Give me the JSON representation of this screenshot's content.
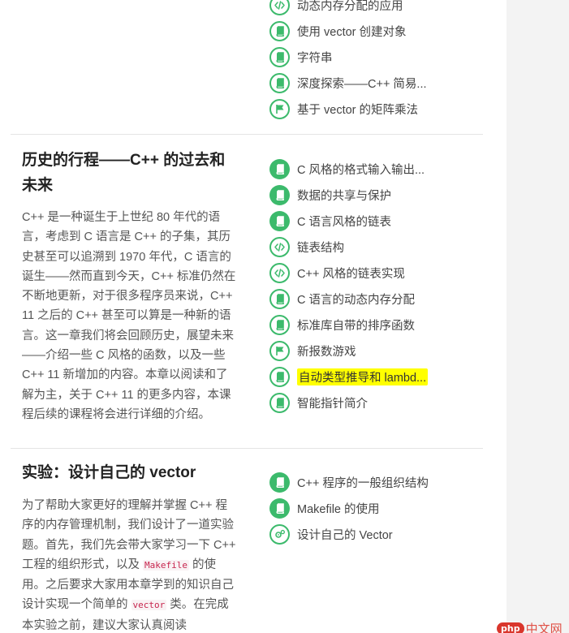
{
  "chapters": [
    {
      "lessons": [
        {
          "label": "动态内存分配的应用",
          "icon": "code-icon",
          "style": "outline"
        },
        {
          "label": "使用 vector 创建对象",
          "icon": "book-icon",
          "style": "outline"
        },
        {
          "label": "字符串",
          "icon": "book-icon",
          "style": "outline"
        },
        {
          "label": "深度探索——C++ 简易...",
          "icon": "book-icon",
          "style": "outline"
        },
        {
          "label": "基于 vector 的矩阵乘法",
          "icon": "flag-icon",
          "style": "outline"
        }
      ]
    },
    {
      "title": "历史的行程——C++ 的过去和未来",
      "description": "C++ 是一种诞生于上世纪 80 年代的语言，考虑到 C 语言是 C++ 的子集，其历史甚至可以追溯到 1970 年代，C 语言的诞生——然而直到今天，C++ 标准仍然在不断地更新，对于很多程序员来说，C++ 11 之后的 C++ 甚至可以算是一种新的语言。这一章我们将会回顾历史，展望未来——介绍一些 C 风格的函数，以及一些 C++ 11 新增加的内容。本章以阅读和了解为主，关于 C++ 11 的更多内容，本课程后续的课程将会进行详细的介绍。",
      "lessons": [
        {
          "label": "C 风格的格式输入输出...",
          "icon": "book-icon",
          "style": "solid"
        },
        {
          "label": "数据的共享与保护",
          "icon": "book-icon",
          "style": "solid"
        },
        {
          "label": "C 语言风格的链表",
          "icon": "book-icon",
          "style": "solid"
        },
        {
          "label": "链表结构",
          "icon": "code-icon",
          "style": "outline"
        },
        {
          "label": "C++ 风格的链表实现",
          "icon": "code-icon",
          "style": "outline"
        },
        {
          "label": "C 语言的动态内存分配",
          "icon": "book-icon",
          "style": "outline"
        },
        {
          "label": "标准库自带的排序函数",
          "icon": "book-icon",
          "style": "outline"
        },
        {
          "label": "新报数游戏",
          "icon": "flag-icon",
          "style": "outline"
        },
        {
          "label": "自动类型推导和 lambd...",
          "icon": "book-icon",
          "style": "outline",
          "highlighted": true
        },
        {
          "label": "智能指针简介",
          "icon": "book-icon",
          "style": "outline"
        }
      ]
    },
    {
      "title": "实验：设计自己的 vector",
      "description_parts": [
        {
          "text": "为了帮助大家更好的理解并掌握 C++ 程序的内存管理机制，我们设计了一道实验题。首先，我们先会带大家学习一下 C++ 工程的组织形式，以及 "
        },
        {
          "code": "Makefile"
        },
        {
          "text": " 的使用。之后要求大家用本章学到的知识自己设计实现一个简单的 "
        },
        {
          "code": "vector"
        },
        {
          "text": " 类。在完成本实验之前，建议大家认真阅读"
        }
      ],
      "lessons": [
        {
          "label": "C++ 程序的一般组织结构",
          "icon": "book-icon",
          "style": "solid"
        },
        {
          "label": "Makefile 的使用",
          "icon": "book-icon",
          "style": "solid"
        },
        {
          "label": "设计自己的 Vector",
          "icon": "gears-icon",
          "style": "outline"
        }
      ]
    }
  ],
  "watermark": {
    "php": "php",
    "cn": "中文网"
  },
  "colors": {
    "accent": "#3cba6c",
    "highlight": "#ffff00",
    "sidebar_bg": "#f3f3f3"
  }
}
